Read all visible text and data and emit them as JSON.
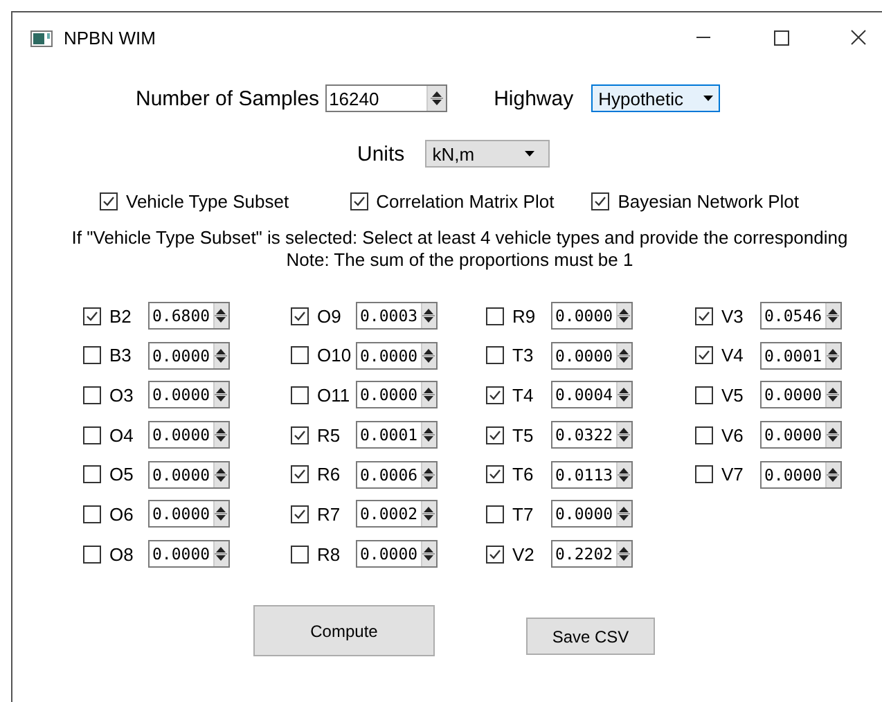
{
  "window": {
    "title": "NPBN WIM"
  },
  "samples": {
    "label": "Number of Samples",
    "value": "16240"
  },
  "highway": {
    "label": "Highway",
    "value": "Hypothetic",
    "focused": true
  },
  "units": {
    "label": "Units",
    "value": "kN,m"
  },
  "options": [
    {
      "label": "Vehicle Type Subset",
      "checked": true
    },
    {
      "label": "Correlation Matrix Plot",
      "checked": true
    },
    {
      "label": "Bayesian Network Plot",
      "checked": true
    }
  ],
  "instructions": [
    "If \"Vehicle Type Subset\" is selected: Select at least 4 vehicle types and provide the corresponding",
    "Note: The sum of the proportions must be 1"
  ],
  "vehicle_columns": [
    [
      {
        "label": "B2",
        "checked": true,
        "value": "0.6800"
      },
      {
        "label": "B3",
        "checked": false,
        "value": "0.0000"
      },
      {
        "label": "O3",
        "checked": false,
        "value": "0.0000"
      },
      {
        "label": "O4",
        "checked": false,
        "value": "0.0000"
      },
      {
        "label": "O5",
        "checked": false,
        "value": "0.0000"
      },
      {
        "label": "O6",
        "checked": false,
        "value": "0.0000"
      },
      {
        "label": "O8",
        "checked": false,
        "value": "0.0000"
      }
    ],
    [
      {
        "label": "O9",
        "checked": true,
        "value": "0.0003"
      },
      {
        "label": "O10",
        "checked": false,
        "value": "0.0000"
      },
      {
        "label": "O11",
        "checked": false,
        "value": "0.0000"
      },
      {
        "label": "R5",
        "checked": true,
        "value": "0.0001"
      },
      {
        "label": "R6",
        "checked": true,
        "value": "0.0006"
      },
      {
        "label": "R7",
        "checked": true,
        "value": "0.0002"
      },
      {
        "label": "R8",
        "checked": false,
        "value": "0.0000"
      }
    ],
    [
      {
        "label": "R9",
        "checked": false,
        "value": "0.0000"
      },
      {
        "label": "T3",
        "checked": false,
        "value": "0.0000"
      },
      {
        "label": "T4",
        "checked": true,
        "value": "0.0004"
      },
      {
        "label": "T5",
        "checked": true,
        "value": "0.0322"
      },
      {
        "label": "T6",
        "checked": true,
        "value": "0.0113"
      },
      {
        "label": "T7",
        "checked": false,
        "value": "0.0000"
      },
      {
        "label": "V2",
        "checked": true,
        "value": "0.2202"
      }
    ],
    [
      {
        "label": "V3",
        "checked": true,
        "value": "0.0546"
      },
      {
        "label": "V4",
        "checked": true,
        "value": "0.0001"
      },
      {
        "label": "V5",
        "checked": false,
        "value": "0.0000"
      },
      {
        "label": "V6",
        "checked": false,
        "value": "0.0000"
      },
      {
        "label": "V7",
        "checked": false,
        "value": "0.0000"
      }
    ]
  ],
  "buttons": [
    {
      "label": "Compute",
      "kind": "large"
    },
    {
      "label": "Save CSV",
      "kind": "small"
    }
  ]
}
